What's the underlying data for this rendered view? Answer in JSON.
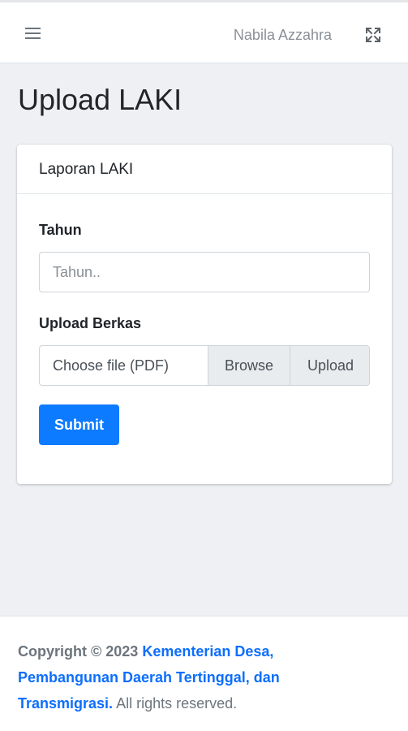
{
  "navbar": {
    "user_name": "Nabila Azzahra",
    "menu_icon": "hamburger-menu-icon",
    "fullscreen_icon": "expand-fullscreen-icon"
  },
  "page": {
    "title": "Upload LAKI"
  },
  "card": {
    "header": "Laporan LAKI",
    "year_label": "Tahun",
    "year_placeholder": "Tahun..",
    "year_value": "",
    "file_label": "Upload Berkas",
    "file_placeholder": "Choose file (PDF)",
    "browse_label": "Browse",
    "upload_label": "Upload",
    "submit_label": "Submit"
  },
  "footer": {
    "prefix": "Copyright © 2023",
    "link_text": "Kementerian Desa, Pembangunan Daerah Tertinggal, dan Transmigrasi.",
    "suffix": "All rights reserved."
  },
  "colors": {
    "primary": "#0d7bff",
    "link": "#0d6efd",
    "background": "#eef0f4"
  }
}
